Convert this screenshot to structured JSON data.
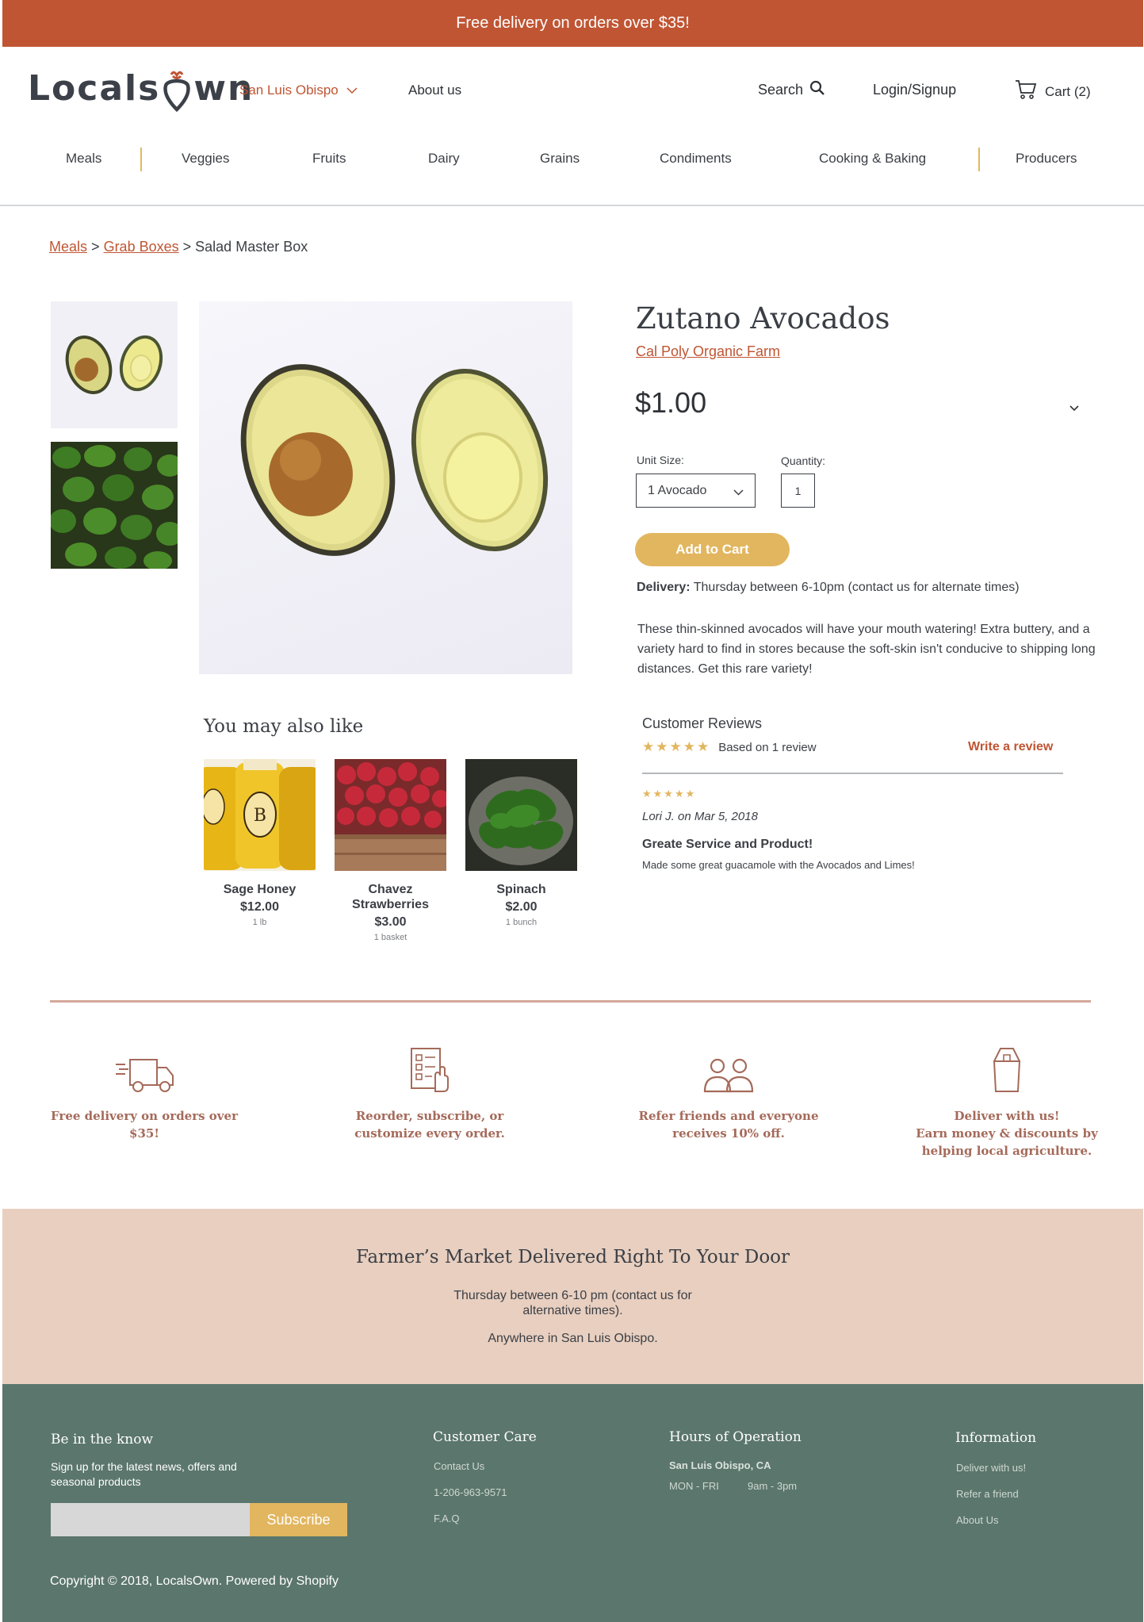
{
  "announcement": "Free delivery on orders over $35!",
  "header": {
    "logo_left": "Locals",
    "logo_right": "wn",
    "location": "San Luis Obispo",
    "about": "About us",
    "search": "Search",
    "login": "Login/Signup",
    "cart": "Cart (2)"
  },
  "categories": [
    "Meals",
    "Veggies",
    "Fruits",
    "Dairy",
    "Grains",
    "Condiments",
    "Cooking & Baking",
    "Producers"
  ],
  "breadcrumb": {
    "crumb1": "Meals",
    "sep": ">",
    "crumb2": "Grab Boxes",
    "current": "Salad Master Box"
  },
  "product": {
    "title": "Zutano Avocados",
    "farm": "Cal Poly Organic Farm",
    "price": "$1.00",
    "unit_label": "Unit Size:",
    "unit_value": "1 Avocado",
    "qty_label": "Quantity:",
    "qty_value": "1",
    "add_to_cart": "Add to Cart",
    "delivery_label": "Delivery:",
    "delivery_text": "Thursday between 6-10pm (contact us for alternate times)",
    "description": "These thin-skinned avocados will have your mouth watering!  Extra buttery, and a variety hard to find in stores because the soft-skin isn't conducive to shipping long distances.  Get this rare variety!"
  },
  "also_like": {
    "title": "You may also like",
    "items": [
      {
        "name": "Sage Honey",
        "price": "$12.00",
        "unit": "1 lb"
      },
      {
        "name": "Chavez Strawberries",
        "price": "$3.00",
        "unit": "1 basket"
      },
      {
        "name": "Spinach",
        "price": "$2.00",
        "unit": "1 bunch"
      }
    ]
  },
  "reviews": {
    "title": "Customer Reviews",
    "rating": 5,
    "summary": "Based on 1 review",
    "write": "Write a review",
    "review": {
      "rating": 5,
      "author": "Lori J. on Mar 5, 2018",
      "headline": "Greate Service and Product!",
      "body": "Made some great guacamole with the Avocados and Limes!"
    }
  },
  "features": [
    {
      "icon": "truck-icon",
      "text": "Free delivery on orders over $35!"
    },
    {
      "icon": "checklist-icon",
      "text": "Reorder, subscribe, or customize every order."
    },
    {
      "icon": "people-icon",
      "text": "Refer friends and everyone receives 10% off."
    },
    {
      "icon": "bag-icon",
      "text": "Deliver with us!\nEarn money & discounts by helping local agriculture."
    }
  ],
  "banner": {
    "heading": "Farmer’s Market Delivered Right To Your Door",
    "line1": "Thursday between 6-10 pm (contact us for\nalternative times).",
    "line2": "Anywhere in San Luis Obispo."
  },
  "footer": {
    "know_title": "Be in the know",
    "know_text": "Sign up for the latest news, offers and\nseasonal products",
    "subscribe": "Subscribe",
    "care_title": "Customer Care",
    "care_links": [
      "Contact Us",
      "1-206-963-9571",
      "F.A.Q"
    ],
    "hours_title": "Hours of Operation",
    "hours_location": "San Luis Obispo, CA",
    "hours_days": "MON - FRI",
    "hours_time": "9am - 3pm",
    "info_title": "Information",
    "info_links": [
      "Deliver with us!",
      "Refer a friend",
      "About Us"
    ],
    "copyright": "Copyright © 2018, LocalsOwn. Powered by Shopify"
  },
  "colors": {
    "brand": "#c05533",
    "accent": "#e2b65f",
    "banner": "#e8cfc0",
    "footer": "#5b766c"
  }
}
